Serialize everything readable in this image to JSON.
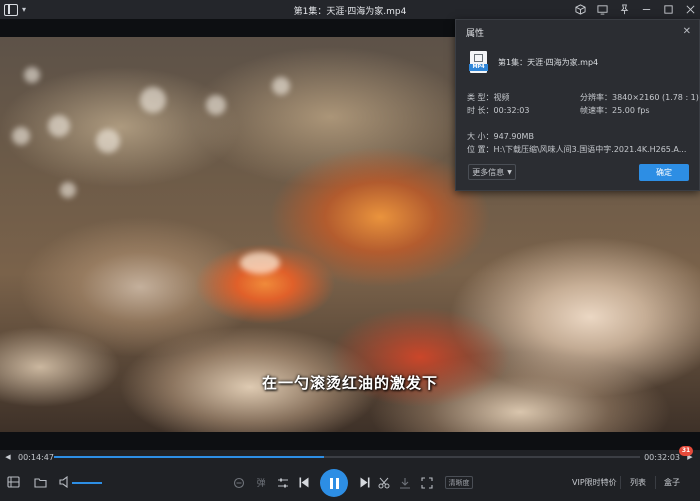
{
  "window": {
    "title": "第1集：天涯·四海为家.mp4"
  },
  "video": {
    "subtitle": "在一勺滚烫红油的激发下"
  },
  "properties_dialog": {
    "title": "属性",
    "file_name": "第1集：天涯·四海为家.mp4",
    "file_badge": "MP4",
    "type_label": "类 型：",
    "type_value": "视频",
    "resolution_label": "分辨率：",
    "resolution_value": "3840×2160 (1.78 : 1)",
    "duration_label": "时 长：",
    "duration_value": "00:32:03",
    "framerate_label": "帧速率：",
    "framerate_value": "25.00 fps",
    "size_label": "大 小：",
    "size_value": "947.90MB",
    "location_label": "位 置：",
    "location_value": "H:\\下载压缩\\风味人间3.国语中字.2021.4K.H265.A...",
    "more_info": "更多信息",
    "ok": "确定"
  },
  "playback": {
    "current_time": "00:14:47",
    "total_time": "00:32:03",
    "progress": 0.461,
    "volume": 0.6
  },
  "controls": {
    "danmaku_label": "弹",
    "quality_label": "清晰度",
    "vip_label": "VIP限时特价",
    "list_label": "列表",
    "extra_label": "盒子",
    "badge_count": "31"
  },
  "colors": {
    "accent": "#2d8ee4",
    "chrome_bg": "#1f2125",
    "dialog_bg": "#2b2d32",
    "badge": "#e64a3a"
  }
}
